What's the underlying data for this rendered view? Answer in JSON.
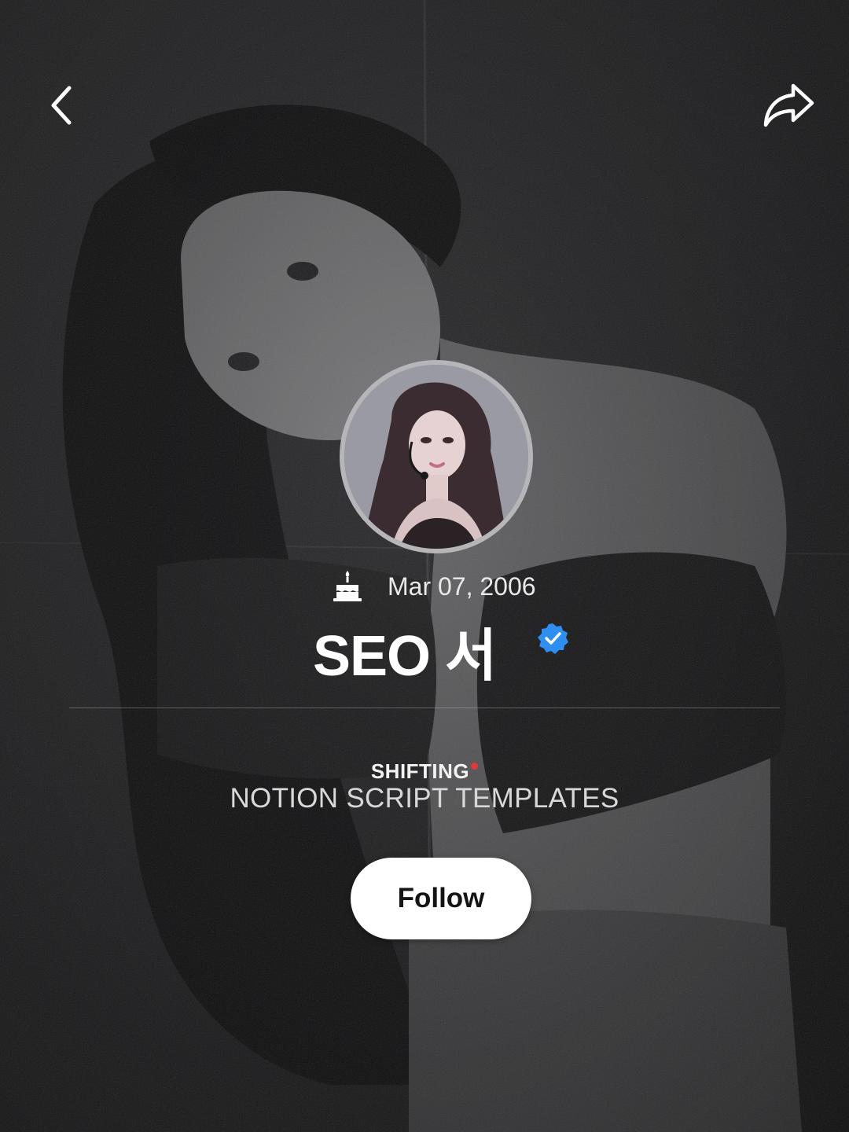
{
  "header": {
    "back_icon": "chevron-left-icon",
    "share_icon": "share-arrow-icon"
  },
  "profile": {
    "avatar_alt": "profile photo",
    "birthday_icon": "cake-icon",
    "birthday": "Mar 07, 2006",
    "name": "SEO 서",
    "verified_icon": "verified-badge-icon",
    "verified_color": "#2f8ff0",
    "bio_title": "SHIFTING",
    "bio_title_dot_color": "#e03a3a",
    "bio_subtitle": "NOTION SCRIPT TEMPLATES"
  },
  "actions": {
    "follow_label": "Follow"
  },
  "theme": {
    "background_tone": "#1f1f21",
    "text_color": "#ffffff",
    "button_bg": "#ffffff",
    "button_text": "#141414"
  }
}
